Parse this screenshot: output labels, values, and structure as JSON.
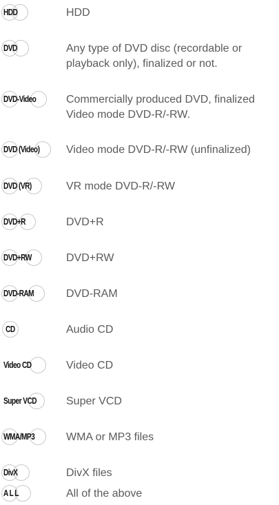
{
  "legend": [
    {
      "icon": "HDD",
      "text": "HDD"
    },
    {
      "icon": "DVD",
      "text": "Any type of DVD disc (recordable or playback only), finalized or not."
    },
    {
      "icon": "DVD-Video",
      "text": "Commercially produced DVD, finalized Video mode DVD-R/-RW."
    },
    {
      "icon": "DVD (Video)",
      "text": "Video mode DVD-R/-RW (unfinalized)"
    },
    {
      "icon": "DVD (VR)",
      "text": "VR mode DVD-R/-RW"
    },
    {
      "icon": "DVD+R",
      "text": "DVD+R"
    },
    {
      "icon": "DVD+RW",
      "text": "DVD+RW"
    },
    {
      "icon": "DVD-RAM",
      "text": "DVD-RAM"
    },
    {
      "icon": "CD",
      "text": "Audio CD"
    },
    {
      "icon": "Video CD",
      "text": "Video CD"
    },
    {
      "icon": "Super VCD",
      "text": "Super VCD"
    },
    {
      "icon": "WMA/MP3",
      "text": "WMA or MP3 files"
    },
    {
      "icon": "DivX",
      "text": "DivX files"
    },
    {
      "icon": "A L L",
      "text": "All of the above"
    }
  ]
}
